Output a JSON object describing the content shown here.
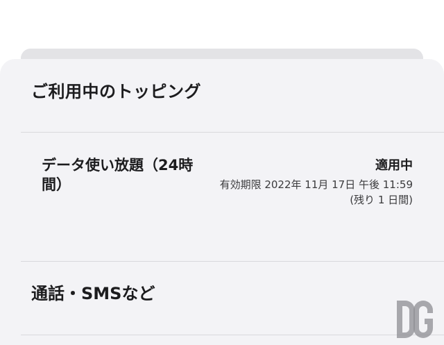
{
  "sheet": {
    "header": "ご利用中のトッピング"
  },
  "toppings": [
    {
      "name": "データ使い放題（24時間）",
      "status": "適用中",
      "expiry": "有効期限 2022年 11月 17日 午後 11:59 (残り 1 日間)"
    }
  ],
  "sections": {
    "calls_sms": "通話・SMSなど"
  },
  "watermark": {
    "icon": "dg-logo-icon"
  }
}
